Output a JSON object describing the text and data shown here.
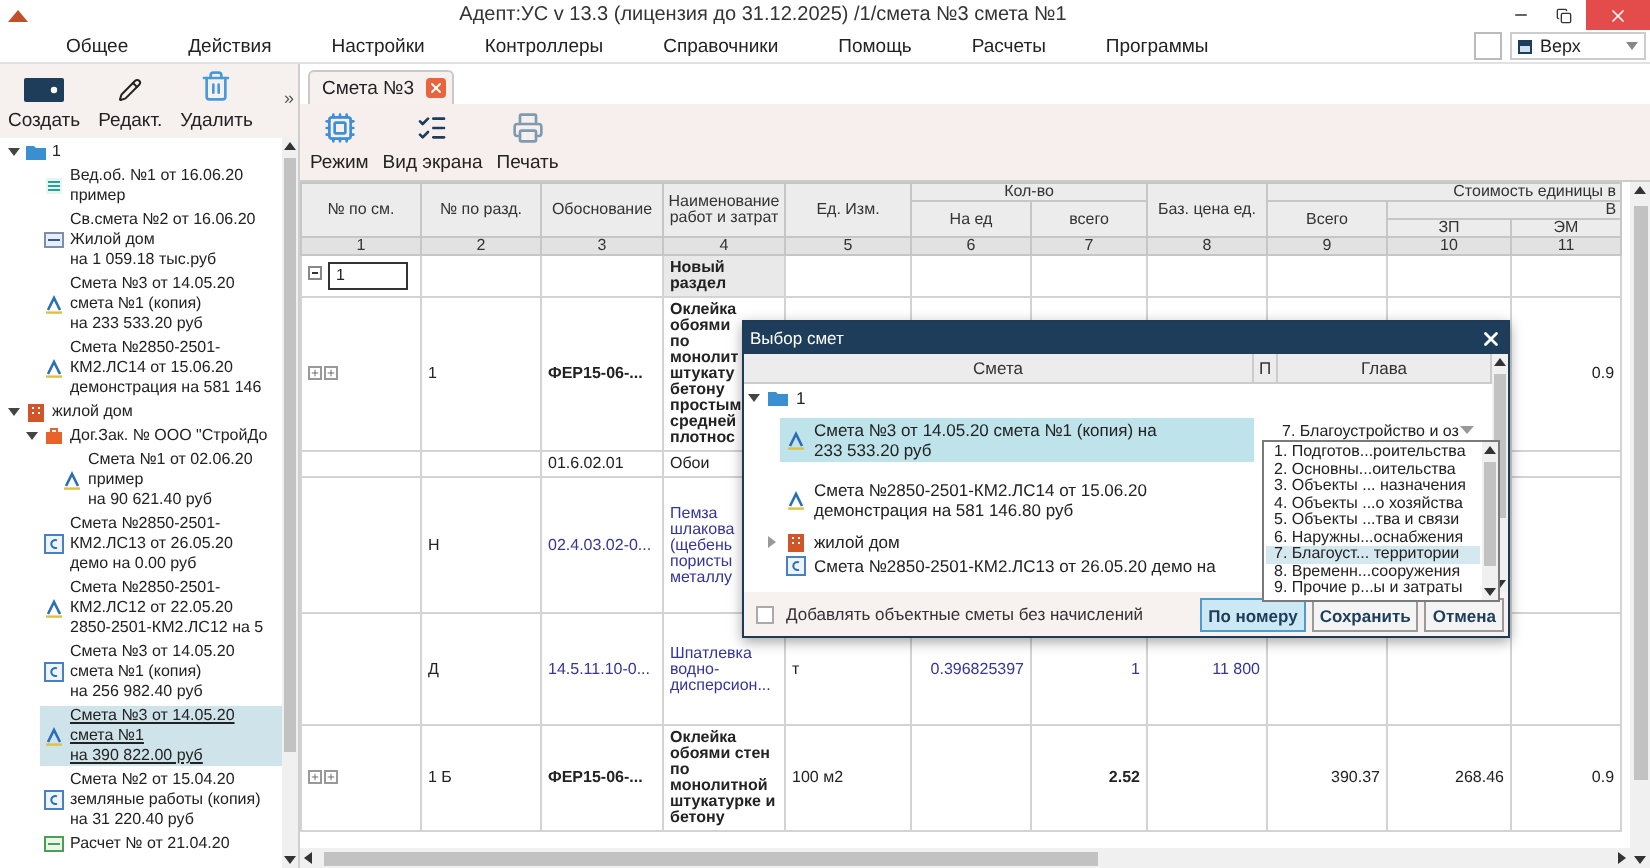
{
  "window": {
    "title": "Адепт:УС v 13.3 (лицензия до 31.12.2025) /1/смета №3 смета №1"
  },
  "menu": [
    "Общее",
    "Действия",
    "Настройки",
    "Контроллеры",
    "Справочники",
    "Помощь",
    "Расчеты",
    "Программы"
  ],
  "view_selector": {
    "value": "Верх"
  },
  "sidebar": {
    "toolbar": [
      {
        "kind": "create",
        "label": "Создать"
      },
      {
        "kind": "edit",
        "label": "Редакт."
      },
      {
        "kind": "delete",
        "label": "Удалить"
      }
    ],
    "more": "»",
    "tree": [
      {
        "lines": [
          "1"
        ],
        "kind": "folder",
        "expanded": true,
        "selected": false,
        "children": [
          {
            "lines": [
              "Вед.об. №1 от 16.06.20",
              "пример"
            ],
            "kind": "list",
            "selected": false
          },
          {
            "lines": [
              "Св.смета №2 от 16.06.20",
              "Жилой дом",
              "на 1 059.18 тыс.руб"
            ],
            "kind": "summary",
            "selected": false
          },
          {
            "lines": [
              "Смета №3 от 14.05.20",
              "смета №1 (копия)",
              "на 233 533.20 руб"
            ],
            "kind": "estimate",
            "selected": false
          },
          {
            "lines": [
              "Смета №2850-2501-",
              "КМ2.ЛС14 от 15.06.20",
              "демонстрация на 581 146"
            ],
            "kind": "estimate",
            "selected": false
          }
        ]
      },
      {
        "lines": [
          "жилой дом"
        ],
        "kind": "object",
        "expanded": true,
        "selected": false,
        "children": [
          {
            "lines": [
              "Дог.Зак. № ООО \"СтройДо"
            ],
            "kind": "contract",
            "expanded": true,
            "selected": false,
            "children": [
              {
                "lines": [
                  "Смета №1 от 02.06.20",
                  "пример",
                  "на 90 621.40 руб"
                ],
                "kind": "estimate",
                "selected": false
              }
            ]
          },
          {
            "lines": [
              "Смета №2850-2501-",
              "КМ2.ЛС13 от 26.05.20",
              "демо на 0.00 руб"
            ],
            "kind": "local",
            "selected": false
          },
          {
            "lines": [
              "Смета №2850-2501-",
              "КМ2.ЛС12 от 22.05.20",
              "2850-2501-КМ2.ЛС12 на 5"
            ],
            "kind": "estimate",
            "selected": false
          },
          {
            "lines": [
              "Смета №3 от 14.05.20",
              "смета №1 (копия)",
              "на 256 982.40 руб"
            ],
            "kind": "local",
            "selected": false
          },
          {
            "lines": [
              "Смета №3 от 14.05.20",
              "смета №1",
              "на 390 822.00 руб"
            ],
            "kind": "estimate",
            "selected": true
          },
          {
            "lines": [
              "Смета №2 от 15.04.20",
              "земляные работы (копия)",
              "на 31 220.40 руб"
            ],
            "kind": "local",
            "selected": false
          },
          {
            "lines": [
              "Расчет № от 21.04.20"
            ],
            "kind": "calculation",
            "selected": false
          }
        ]
      }
    ]
  },
  "tabs": [
    {
      "label": "Смета №3",
      "selected": true
    }
  ],
  "doc_toolbar": [
    {
      "kind": "mode",
      "label": "Режим"
    },
    {
      "kind": "view",
      "label": "Вид экрана"
    },
    {
      "kind": "print",
      "label": "Печать"
    }
  ],
  "table": {
    "column_groups": [
      {
        "label": "Кол-во"
      },
      {
        "label": "Стоимость единицы в"
      },
      {
        "label": "В"
      }
    ],
    "columns": [
      {
        "label": "№ по см.",
        "number": "1"
      },
      {
        "label": "№ по разд.",
        "number": "2"
      },
      {
        "label": "Обоснование",
        "number": "3"
      },
      {
        "label": "Наименование работ и затрат",
        "number": "4"
      },
      {
        "label": "Ед. Изм.",
        "number": "5"
      },
      {
        "label": "На ед",
        "number": "6"
      },
      {
        "label": "всего",
        "number": "7"
      },
      {
        "label": "Баз. цена ед.",
        "number": "8"
      },
      {
        "label": "Всего",
        "number": "9"
      },
      {
        "label": "ЗП",
        "number": "10"
      },
      {
        "label": "ЭМ",
        "number": "11"
      }
    ],
    "rows": [
      {
        "kind": "section",
        "cells": {
          "col_1": "1",
          "col_4": "Новый раздел"
        }
      },
      {
        "kind": "work",
        "cells": {
          "col_2": "1",
          "col_3": "ФЕР15-06-...",
          "col_4": "Оклейка обоями по монолит штукату бетону простым средней плотнос",
          "col_11": "0.9"
        }
      },
      {
        "kind": "resource",
        "cells": {
          "col_3": "01.6.02.01",
          "col_4": "Обои"
        }
      },
      {
        "kind": "material",
        "cells": {
          "col_2": "Н",
          "col_3": "02.4.03.02-0...",
          "col_4": "Пемза шлакова (щебень пористы металлу"
        }
      },
      {
        "kind": "material",
        "cells": {
          "col_2": "Д",
          "col_3": "14.5.11.10-0...",
          "col_4": "Шпатлевка водно-дисперсион...",
          "col_5": "т",
          "col_6": "0.396825397",
          "col_7": "1",
          "col_8": "11 800"
        }
      },
      {
        "kind": "work",
        "cells": {
          "col_2": "1 Б",
          "col_3": "ФЕР15-06-...",
          "col_4": "Оклейка обоями стен по монолитной штукатурке и бетону",
          "col_5": "100 м2",
          "col_7": "2.52",
          "col_9": "390.37",
          "col_10": "268.46",
          "col_11": "0.9"
        }
      }
    ]
  },
  "dialog": {
    "title": "Выбор смет",
    "columns": [
      "Смета",
      "П",
      "Глава"
    ],
    "tree": [
      {
        "lines": [
          "1"
        ],
        "kind": "folder",
        "expanded": true,
        "selected": false,
        "children": [
          {
            "lines": [
              "Смета №3 от 14.05.20 смета №1 (копия) на",
              "233 533.20 руб"
            ],
            "kind": "estimate",
            "selected": true,
            "chapter": "7. Благоустройство и оз"
          },
          {
            "lines": [
              "Смета №2850-2501-КМ2.ЛС14 от 15.06.20",
              "демонстрация на 581 146.80 руб"
            ],
            "kind": "estimate",
            "selected": false
          },
          {
            "lines": [
              "жилой дом"
            ],
            "kind": "object",
            "expanded": false,
            "selected": false
          },
          {
            "lines": [
              "Смета №2850-2501-КМ2.ЛС13 от 26.05.20 демо на"
            ],
            "kind": "local",
            "selected": false
          }
        ]
      }
    ],
    "chapter_options": [
      {
        "label": "1. Подготов...роительства",
        "selected": false
      },
      {
        "label": "2. Основны...оительства",
        "selected": false
      },
      {
        "label": "3. Объекты ... назначения",
        "selected": false
      },
      {
        "label": "4. Объекты ...о хозяйства",
        "selected": false
      },
      {
        "label": "5. Объекты ...тва и связи",
        "selected": false
      },
      {
        "label": "6. Наружны...оснабжения",
        "selected": false
      },
      {
        "label": "7. Благоуст... территории",
        "selected": true
      },
      {
        "label": "8. Временн...сооружения",
        "selected": false
      },
      {
        "label": "9. Прочие р...ы и затраты",
        "selected": false
      }
    ],
    "checkbox": {
      "label": "Добавлять объектные сметы без начислений",
      "checked": false
    },
    "buttons": [
      {
        "label": "По номеру",
        "kind": "primary"
      },
      {
        "label": "Сохранить",
        "kind": "normal"
      },
      {
        "label": "Отмена",
        "kind": "normal"
      }
    ]
  }
}
